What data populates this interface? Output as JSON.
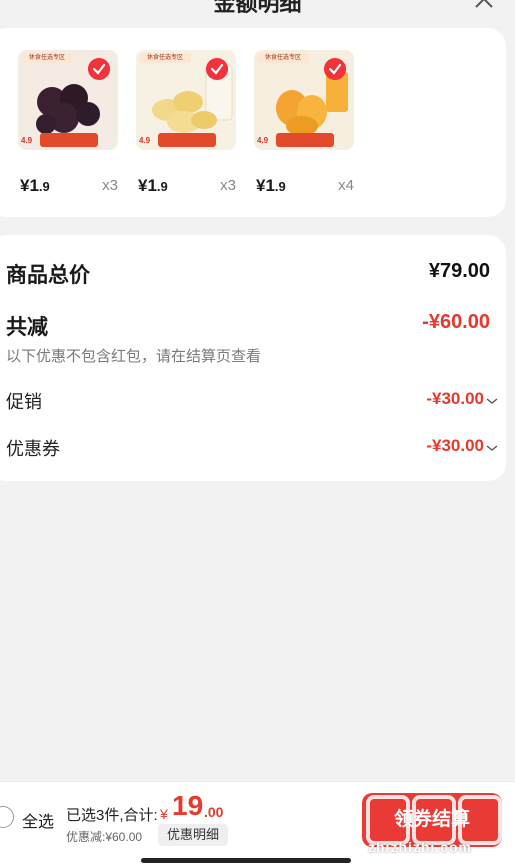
{
  "header": {
    "title": "金额明细"
  },
  "products": [
    {
      "price_int": "¥1",
      "price_dec": ".9",
      "qty": "x3",
      "thumb_tag": "休食任选专区",
      "thumb_price": "4.9",
      "color_a": "#3b2030",
      "color_b": "#f4ebe3",
      "icon": "prune-image"
    },
    {
      "price_int": "¥1",
      "price_dec": ".9",
      "qty": "x3",
      "thumb_tag": "休食任选专区",
      "thumb_price": "4.9",
      "color_a": "#f2d98a",
      "color_b": "#f7f1e4",
      "icon": "banana-chips-image"
    },
    {
      "price_int": "¥1",
      "price_dec": ".9",
      "qty": "x4",
      "thumb_tag": "休食任选专区",
      "thumb_price": "4.9",
      "color_a": "#f4a430",
      "color_b": "#f6efe0",
      "icon": "dried-mango-image"
    }
  ],
  "summary": {
    "total_label": "商品总价",
    "total_value": "¥79.00",
    "discount_label": "共减",
    "discount_value": "-¥60.00",
    "discount_note": "以下优惠不包含红包，请在结算页查看",
    "promo_label": "促销",
    "promo_value": "-¥30.00",
    "coupon_label": "优惠券",
    "coupon_value": "-¥30.00"
  },
  "bottom": {
    "select_all": "全选",
    "selected_info": "已选3件,合计:",
    "currency": "¥",
    "sum_int": "19",
    "sum_dec": ".00",
    "saved": "优惠减:¥60.00",
    "detail_chip": "优惠明细",
    "checkout": "领券结算",
    "watermark": "zhizhizhi.com"
  },
  "colors": {
    "accent": "#ea3a36",
    "discount": "#e8382b",
    "background": "#f2f2f2"
  }
}
